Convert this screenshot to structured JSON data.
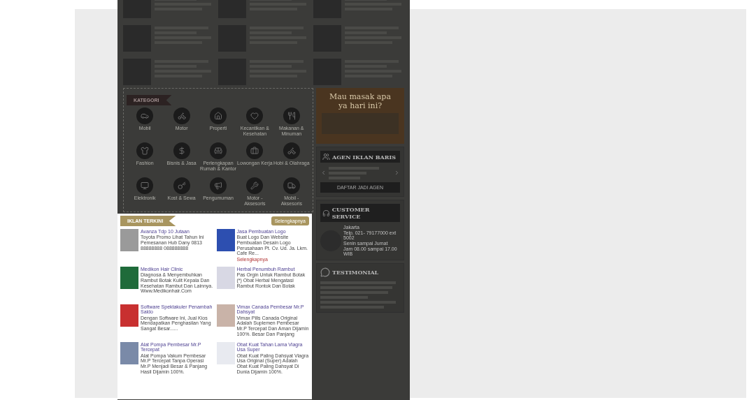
{
  "categories": {
    "title": "KATEGORI",
    "items": [
      "Mobil",
      "Motor",
      "Properti",
      "Kecantikan & Kesehatan",
      "Makanan & Minuman",
      "Fashion",
      "Bisnis & Jasa",
      "Perlengkapan Rumah & Kantor",
      "Lowongan Kerja",
      "Hobi & Olahraga",
      "Elektronik",
      "Kost & Sewa",
      "Pengumuman",
      "Motor - Aksesoris",
      "Mobil - Aksesoris"
    ]
  },
  "latest": {
    "title": "IKLAN TERKINI",
    "more": "Selengkapnya",
    "items": [
      {
        "title": "Avanza Tdp 10 Jutaan",
        "desc": "Toyota Promo Lihat Tahun Ini Pemesanan Hub Dany 0813 88888888 088888888"
      },
      {
        "title": "Jasa Pembuatan Logo",
        "desc": "Buat Logo Dan Website Pembuatan Desain Logo Perusahaan Pt. Cv. Ud. Ja. Lkm. Cafe Re...",
        "link": "Selengkapnya"
      },
      {
        "title": "Medikon Hair Clinic",
        "desc": "Diagnosa & Menyembuhkan Rambut Botak Kulit Kepala Dan Kesehatan Rambut Dan Lainnya. Www.Medikonhair.Com"
      },
      {
        "title": "Herbal Penumbuh Rambut",
        "desc": "Pas Orgin Untuk Rambut Botak (*) Obat Herbal Mengatasi Rambut Rontok Dan Botak"
      },
      {
        "title": "Software Spektakuler Penambah Saldo",
        "desc": "Dengan Software Ini, Jual Kios Mendapatkan Penghasilan Yang Sangat Besar......"
      },
      {
        "title": "Vimax Canada Pembesar Mr.P Dahsyat",
        "desc": "Vimax Pills Canada Original Adalah Suplemen Pembesar Mr.P Tercepat Dan Aman Dijamin 100%. Besar Dan Panjang"
      },
      {
        "title": "Alat Pompa Pembesar Mr.P Tercepat",
        "desc": "Alat Pompa Vakum Pembesar Mr.P Tercepat Tanpa Operasi Mr.P Menjadi Besar & Panjang Hasil Dijamin 100%."
      },
      {
        "title": "Obat Kuat Tahan Lama Viagra Usa Super",
        "desc": "Obat Kuat Paling Dahsyat Viagra Usa Original (Super) Adalah Obat Kuat Paling Dahsyat Di Dunia Dijamin 100%."
      }
    ]
  },
  "banner": {
    "text": "Mau masak apa ya hari ini?"
  },
  "agent": {
    "title": "AGEN IKLAN BARIS",
    "cta": "DAFTAR JADI AGEN"
  },
  "service": {
    "title": "CUSTOMER SERVICE",
    "lines": [
      "Jakarta",
      "Telp. 021- 79177000 ext 5002",
      "Senin sampai Jumat",
      "Jam 08.00 sampai 17.00 WIB"
    ]
  },
  "testimonial": {
    "title": "TESTIMONIAL"
  }
}
